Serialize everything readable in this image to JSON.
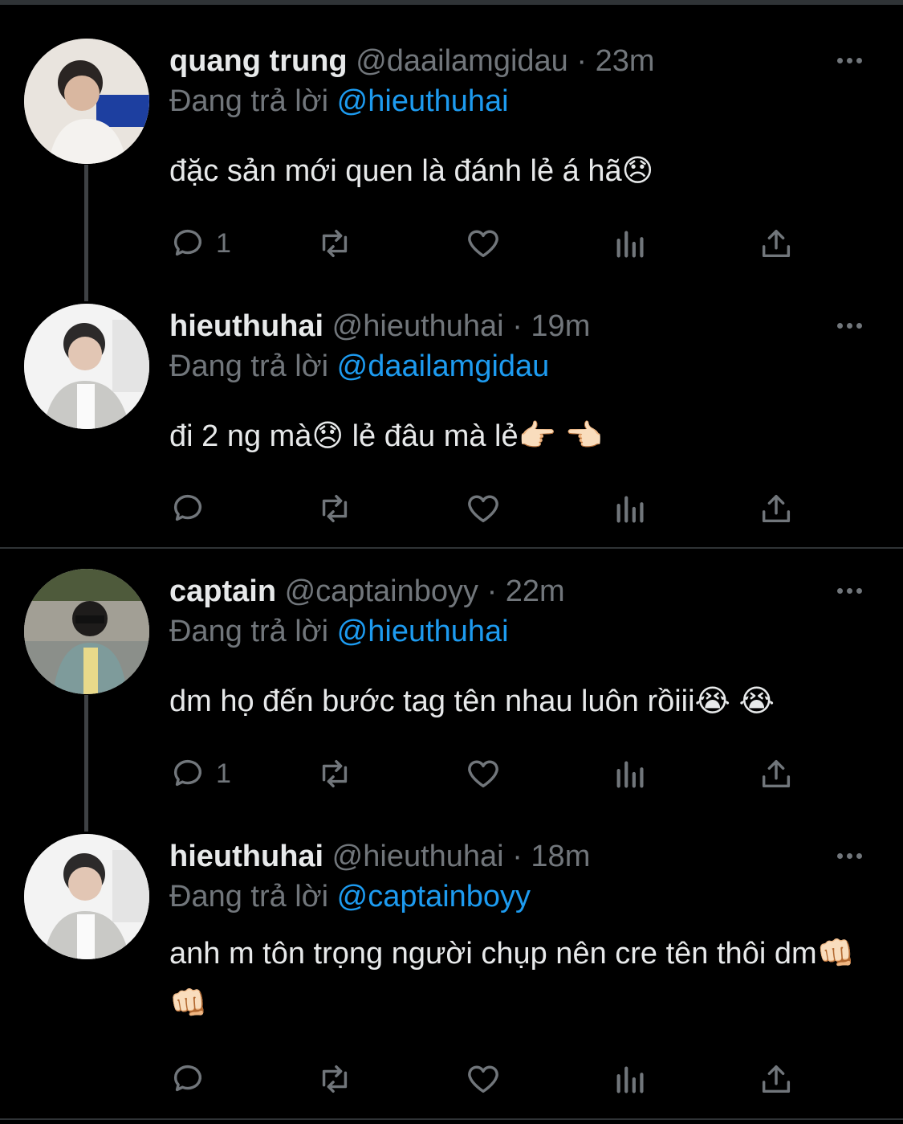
{
  "reply_prefix": "Đang trả lời",
  "tweets": [
    {
      "name": "quang trung",
      "handle": "@daailamgidau",
      "separator": "·",
      "time": "23m",
      "reply_to": "@hieuthuhai",
      "text": "đặc sản mới quen là đánh lẻ á hã😞",
      "reply_count": "1"
    },
    {
      "name": "hieuthuhai",
      "handle": "@hieuthuhai",
      "separator": "·",
      "time": "19m",
      "reply_to": "@daailamgidau",
      "text": "đi 2 ng mà😞  lẻ đâu mà lẻ👉🏻 👈🏻",
      "reply_count": ""
    },
    {
      "name": "captain",
      "handle": "@captainboyy",
      "separator": "·",
      "time": "22m",
      "reply_to": "@hieuthuhai",
      "text": "dm họ đến bước tag tên nhau luôn rồiii😭 😭",
      "reply_count": "1"
    },
    {
      "name": "hieuthuhai",
      "handle": "@hieuthuhai",
      "separator": "·",
      "time": "18m",
      "reply_to": "@captainboyy",
      "text": "anh m tôn trọng người chụp nên cre tên thôi dm👊🏻 👊🏻",
      "reply_count": ""
    }
  ],
  "icons": [
    "reply-icon",
    "retweet-icon",
    "like-icon",
    "analytics-icon",
    "share-icon",
    "more-icon"
  ],
  "colors": {
    "background": "#000000",
    "text": "#e7e9ea",
    "muted": "#71767b",
    "link": "#1d9bf0",
    "divider": "#2f3336"
  }
}
